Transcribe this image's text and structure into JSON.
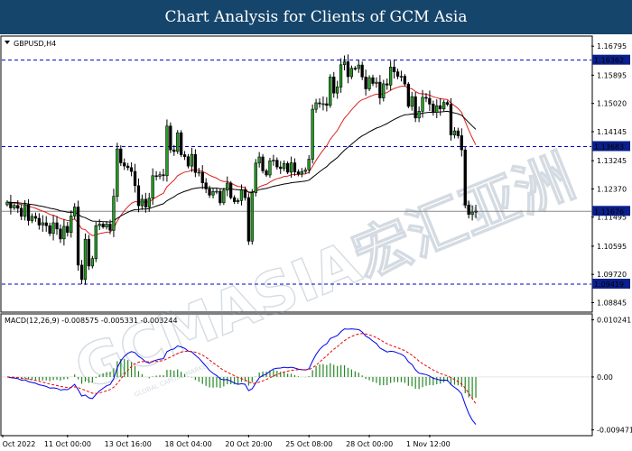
{
  "header": {
    "title": "Chart Analysis for Clients of GCM Asia"
  },
  "watermark": {
    "text": "GCMASIA宏汇亚洲",
    "subtext": "GLOBAL CAPITAL MARKETS"
  },
  "chart_data": [
    {
      "type": "candlestick",
      "title": "GBPUSD,H4",
      "y_ticks": [
        "1.16795",
        "1.15895",
        "1.15020",
        "1.14145",
        "1.13245",
        "1.12370",
        "1.11495",
        "1.10595",
        "1.09720",
        "1.08845"
      ],
      "ylim": [
        1.0858,
        1.1708
      ],
      "x_ticks": [
        "6 Oct 2022",
        "11 Oct 00:00",
        "13 Oct 16:00",
        "18 Oct 04:00",
        "20 Oct 20:00",
        "25 Oct 08:00",
        "28 Oct 00:00",
        "1 Nov 12:00"
      ],
      "levels": [
        {
          "value": 1.16362,
          "label": "1.16362",
          "style": "dashed",
          "color": "#0000cc"
        },
        {
          "value": 1.13683,
          "label": "1.13683",
          "style": "dashed",
          "color": "#0000cc"
        },
        {
          "value": 1.09419,
          "label": "1.09419",
          "style": "dashed",
          "color": "#0000cc"
        }
      ],
      "current_price": {
        "value": 1.11676,
        "label": "1.11676"
      },
      "moving_averages": [
        {
          "color": "#dd2020"
        },
        {
          "color": "#000000"
        }
      ],
      "closes": [
        1.1196,
        1.1178,
        1.1186,
        1.1177,
        1.1152,
        1.1188,
        1.1139,
        1.1152,
        1.1146,
        1.1125,
        1.1132,
        1.1123,
        1.1099,
        1.1132,
        1.1113,
        1.1082,
        1.1121,
        1.1102,
        1.1153,
        1.1181,
        1.1001,
        1.0956,
        1.1081,
        1.0998,
        1.1021,
        1.1123,
        1.1128,
        1.1119,
        1.1128,
        1.1109,
        1.1214,
        1.1361,
        1.1318,
        1.1308,
        1.1303,
        1.1291,
        1.1247,
        1.1185,
        1.1205,
        1.1181,
        1.1208,
        1.1278,
        1.1276,
        1.1281,
        1.1278,
        1.1432,
        1.1358,
        1.1353,
        1.1411,
        1.1343,
        1.1337,
        1.1308,
        1.1344,
        1.1288,
        1.1289,
        1.1256,
        1.1237,
        1.1218,
        1.1229,
        1.123,
        1.1194,
        1.1233,
        1.1255,
        1.121,
        1.1197,
        1.1201,
        1.1234,
        1.121,
        1.1075,
        1.1225,
        1.1317,
        1.1336,
        1.1293,
        1.128,
        1.1324,
        1.1326,
        1.1305,
        1.13,
        1.1316,
        1.1289,
        1.1318,
        1.129,
        1.1283,
        1.1291,
        1.1296,
        1.1329,
        1.1484,
        1.1504,
        1.1501,
        1.1501,
        1.1496,
        1.1584,
        1.1534,
        1.1553,
        1.1622,
        1.1631,
        1.1585,
        1.1611,
        1.161,
        1.1621,
        1.1584,
        1.1547,
        1.1582,
        1.1564,
        1.1568,
        1.1519,
        1.1563,
        1.1559,
        1.1615,
        1.16,
        1.1586,
        1.1586,
        1.1562,
        1.1493,
        1.1523,
        1.1457,
        1.1478,
        1.1521,
        1.1518,
        1.15,
        1.1474,
        1.1495,
        1.1485,
        1.1505,
        1.1499,
        1.1404,
        1.1417,
        1.1402,
        1.1358,
        1.1187,
        1.1158,
        1.1165,
        1.1168
      ]
    },
    {
      "type": "histogram+line",
      "title": "MACD(12,26,9) -0.008575 -0.005331 -0.003244",
      "y_ticks": [
        "0.010241",
        "0.00",
        "-0.009471"
      ],
      "ylim": [
        -0.01035,
        0.01114
      ],
      "series": [
        {
          "kind": "histogram",
          "color": "#228822"
        },
        {
          "kind": "line",
          "color": "#0000ee"
        },
        {
          "kind": "dashed-line",
          "color": "#ee0000"
        }
      ]
    }
  ]
}
